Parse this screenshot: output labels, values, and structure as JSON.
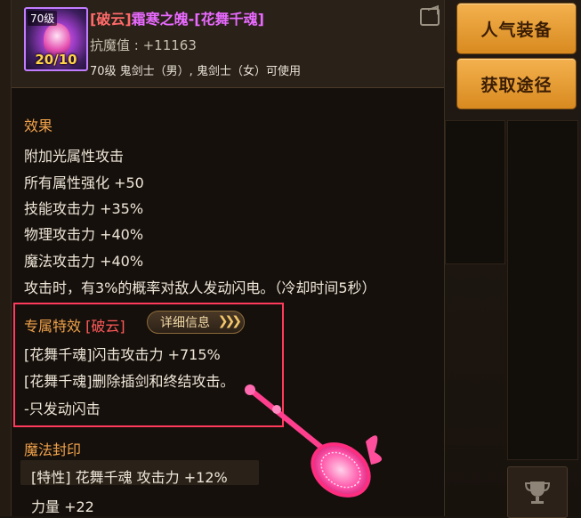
{
  "side_buttons": {
    "popular_label": "人气装备",
    "obtain_label": "获取途径"
  },
  "item": {
    "level_tag": "70级",
    "count": "20/10",
    "name_prefix": "[破云]",
    "name_main": "霜寒之魄-[花舞千魂]",
    "resist_label": "抗魔值 : ",
    "resist_value": "+11163",
    "usable": "70级 鬼剑士（男）, 鬼剑士（女）可使用"
  },
  "effects": {
    "title": "效果",
    "lines": [
      "附加光属性攻击",
      "所有属性强化 +50",
      "技能攻击力 +35%",
      "物理攻击力 +40%",
      "魔法攻击力 +40%",
      "攻击时，有3%的概率对敌人发动闪电。（冷却时间5秒）"
    ]
  },
  "exclusive": {
    "title": "专属特效",
    "tag": "[破云]",
    "detail_label": "详细信息",
    "lines": [
      "[花舞千魂]闪击攻击力 +715%",
      "[花舞千魂]删除插剑和终结攻击。",
      "-只发动闪击"
    ]
  },
  "magic_seal": {
    "title": "魔法封印",
    "lines": [
      "[特性] 花舞千魂 攻击力 +12%",
      "力量 +22"
    ]
  },
  "colors": {
    "accent_orange": "#f0a24a",
    "item_name_purple": "#e96aff",
    "tag_red": "#ff6a6a",
    "highlight_box_red": "#ff3a5a"
  },
  "icons": {
    "share": "share-icon",
    "detail_arrow": "double-chevron-right-icon",
    "trophy": "trophy-icon",
    "weapon": "racket-weapon-icon"
  }
}
